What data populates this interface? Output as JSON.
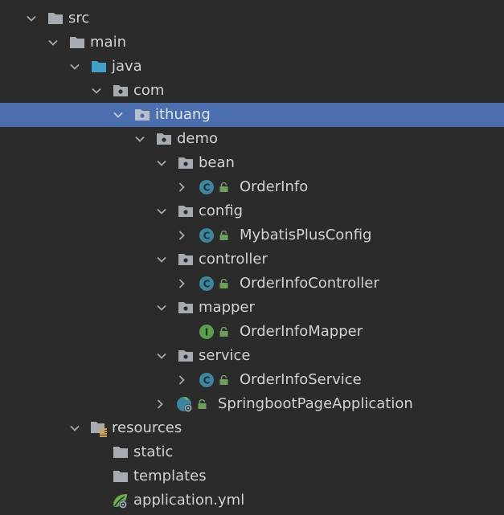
{
  "tree": {
    "src": "src",
    "main": "main",
    "java": "java",
    "com": "com",
    "ithuang": "ithuang",
    "demo": "demo",
    "bean": "bean",
    "order_info": "OrderInfo",
    "config": "config",
    "mybatis_plus_config": "MybatisPlusConfig",
    "controller": "controller",
    "order_info_controller": "OrderInfoController",
    "mapper": "mapper",
    "order_info_mapper": "OrderInfoMapper",
    "service": "service",
    "order_info_service": "OrderInfoService",
    "springboot_app": "SpringbootPageApplication",
    "resources": "resources",
    "static": "static",
    "templates": "templates",
    "application_yml": "application.yml"
  },
  "icon_letters": {
    "class": "C",
    "interface": "I"
  },
  "colors": {
    "background": "#2b2b2b",
    "selection": "#4b6eaf",
    "text": "#cfd3d8",
    "folder": "#a6abb2",
    "source_folder": "#3fa0c8",
    "class_icon": "#3e86a0",
    "interface_icon": "#5a9e4a",
    "lock": "#6ba05a",
    "spring": "#6ab04a"
  }
}
